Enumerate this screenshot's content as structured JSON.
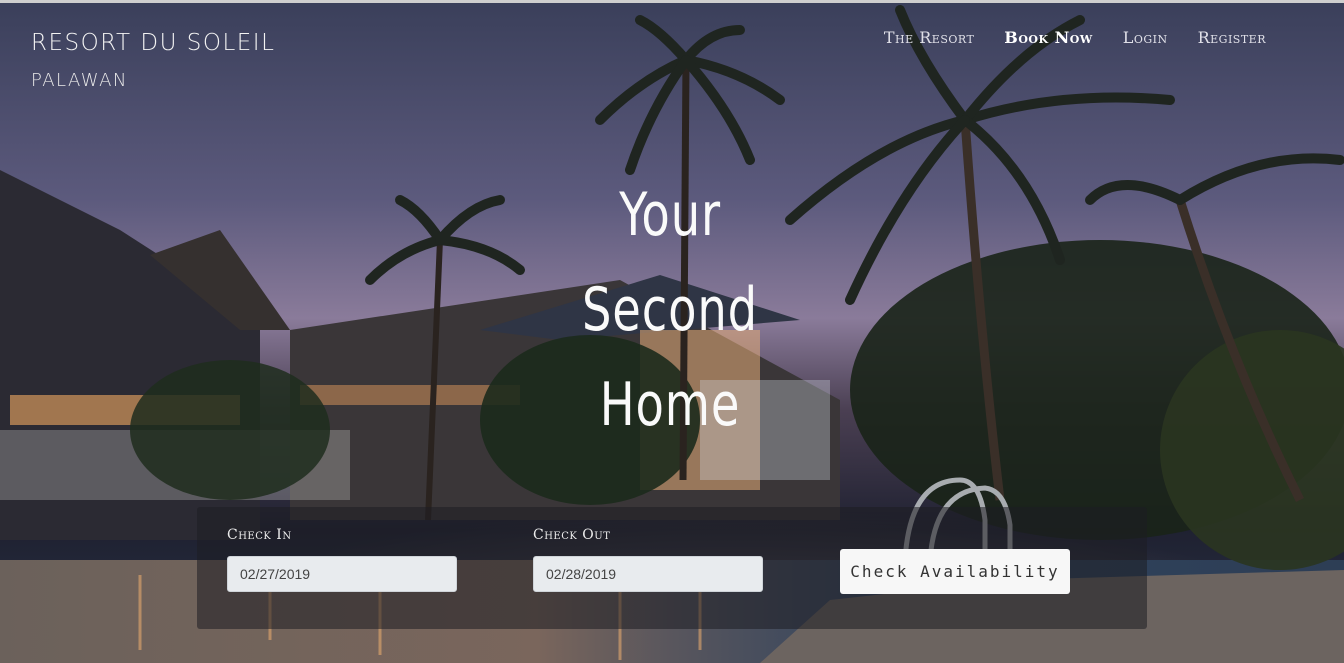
{
  "brand": {
    "name": "RESORT DU SOLEIL",
    "location": "PALAWAN"
  },
  "nav": {
    "items": [
      {
        "label": "The Resort"
      },
      {
        "label": "Book Now"
      },
      {
        "label": "Login"
      },
      {
        "label": "Register"
      }
    ]
  },
  "hero": {
    "tagline_lines": [
      "Your",
      "Second",
      "Home"
    ]
  },
  "booking": {
    "check_in_label": "Check In",
    "check_in_value": "02/27/2019",
    "check_out_label": "Check Out",
    "check_out_value": "02/28/2019",
    "submit_label": "Check Availability"
  }
}
